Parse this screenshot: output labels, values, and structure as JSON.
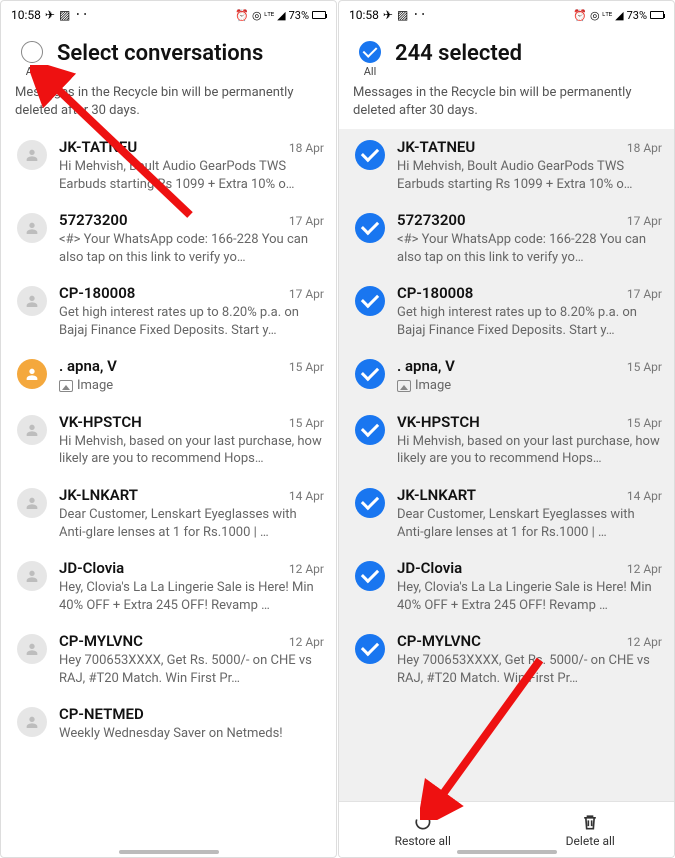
{
  "status": {
    "time": "10:58",
    "battery_pct": "73%",
    "indicators": "◎ ⓘ ᵛᵒ ᴸᵀᴱ ◢"
  },
  "left": {
    "all_label": "All",
    "title": "Select conversations",
    "subtext": "Messages in the Recycle bin will be permanently deleted after 30 days.",
    "rows": [
      {
        "sender": "JK-TATNEU",
        "date": "18 Apr",
        "preview": "Hi Mehvish, Boult Audio GearPods TWS Earbuds starting Rs 1099 + Extra 10% o…",
        "avatar": "generic"
      },
      {
        "sender": "57273200",
        "date": "17 Apr",
        "preview": "<#> Your WhatsApp code: 166-228 You can also tap on this link to verify yo…",
        "avatar": "generic"
      },
      {
        "sender": "CP-180008",
        "date": "17 Apr",
        "preview": "Get high interest rates up to 8.20% p.a. on Bajaj Finance Fixed Deposits. Start y…",
        "avatar": "generic"
      },
      {
        "sender": ". apna, V",
        "date": "15 Apr",
        "preview": "Image",
        "avatar": "person",
        "image": true
      },
      {
        "sender": "VK-HPSTCH",
        "date": "15 Apr",
        "preview": "Hi Mehvish, based on your last purchase, how likely are you to recommend Hops…",
        "avatar": "generic"
      },
      {
        "sender": "JK-LNKART",
        "date": "14 Apr",
        "preview": "Dear Customer, Lenskart Eyeglasses with Anti-glare lenses at 1 for Rs.1000 | …",
        "avatar": "generic"
      },
      {
        "sender": "JD-Clovia",
        "date": "12 Apr",
        "preview": "Hey, Clovia's La La Lingerie Sale is Here! Min 40% OFF + Extra 245 OFF! Revamp …",
        "avatar": "generic"
      },
      {
        "sender": "CP-MYLVNC",
        "date": "12 Apr",
        "preview": "Hey 700653XXXX,   Get Rs. 5000/- on CHE vs RAJ,   #T20 Match.   Win First Pr…",
        "avatar": "generic"
      },
      {
        "sender": "CP-NETMED",
        "date": "",
        "preview": "Weekly Wednesday Saver on Netmeds!",
        "avatar": "generic"
      }
    ]
  },
  "right": {
    "all_label": "All",
    "title": "244 selected",
    "subtext": "Messages in the Recycle bin will be permanently deleted after 30 days.",
    "restore_label": "Restore all",
    "delete_label": "Delete all",
    "rows": [
      {
        "sender": "JK-TATNEU",
        "date": "18 Apr",
        "preview": "Hi Mehvish, Boult Audio GearPods TWS Earbuds starting Rs 1099 + Extra 10% o…"
      },
      {
        "sender": "57273200",
        "date": "17 Apr",
        "preview": "<#> Your WhatsApp code: 166-228 You can also tap on this link to verify yo…"
      },
      {
        "sender": "CP-180008",
        "date": "17 Apr",
        "preview": "Get high interest rates up to 8.20% p.a. on Bajaj Finance Fixed Deposits. Start y…"
      },
      {
        "sender": ". apna, V",
        "date": "15 Apr",
        "preview": "Image",
        "image": true
      },
      {
        "sender": "VK-HPSTCH",
        "date": "15 Apr",
        "preview": "Hi Mehvish, based on your last purchase, how likely are you to recommend Hops…"
      },
      {
        "sender": "JK-LNKART",
        "date": "14 Apr",
        "preview": "Dear Customer, Lenskart Eyeglasses with Anti-glare lenses at 1 for Rs.1000 | …"
      },
      {
        "sender": "JD-Clovia",
        "date": "12 Apr",
        "preview": "Hey, Clovia's La La Lingerie Sale is Here! Min 40% OFF + Extra 245 OFF! Revamp …"
      },
      {
        "sender": "CP-MYLVNC",
        "date": "12 Apr",
        "preview": "Hey 700653XXXX,   Get Rs. 5000/- on CHE vs RAJ,   #T20 Match.   Win First Pr…"
      }
    ]
  }
}
